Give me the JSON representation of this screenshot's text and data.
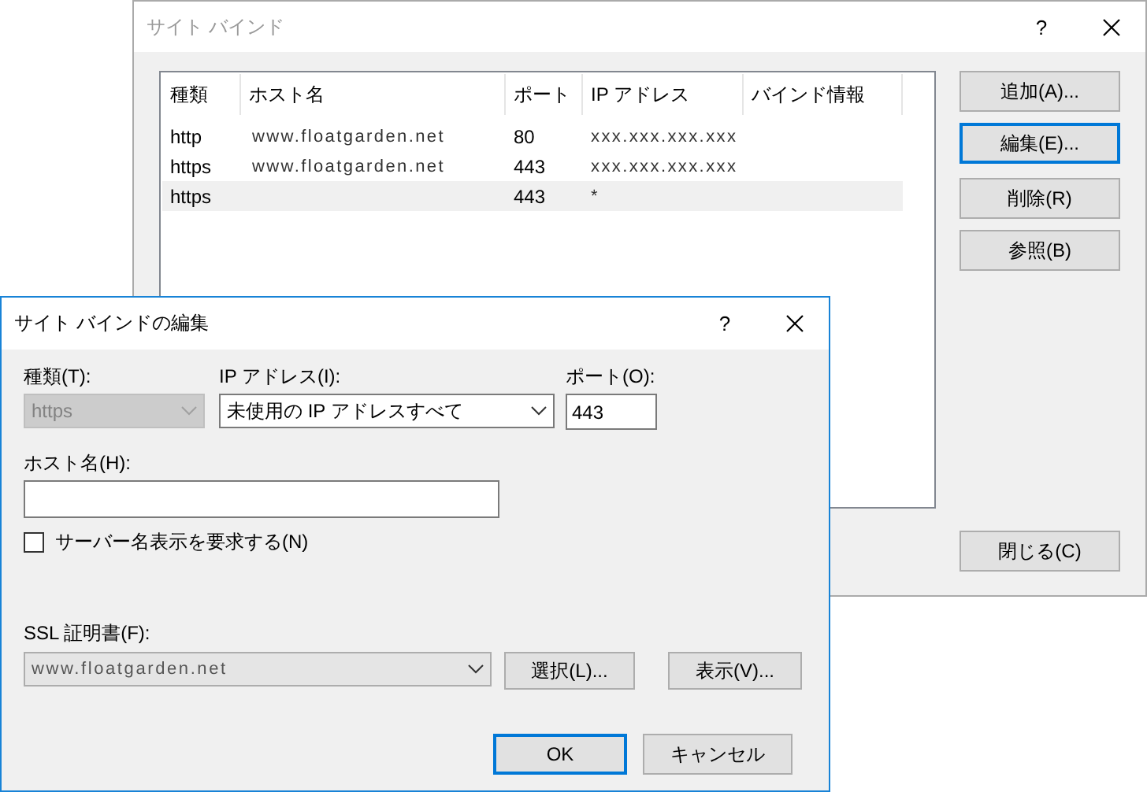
{
  "bindings_window": {
    "title": "サイト バインド",
    "help": "?",
    "active": false,
    "table": {
      "columns": [
        "種類",
        "ホスト名",
        "ポート",
        "IP アドレス",
        "バインド情報"
      ],
      "rows": [
        {
          "type": "http",
          "host": "www.floatgarden.net",
          "port": "80",
          "ip": "xxx.xxx.xxx.xxx",
          "selected": false
        },
        {
          "type": "https",
          "host": "www.floatgarden.net",
          "port": "443",
          "ip": "xxx.xxx.xxx.xxx",
          "selected": false
        },
        {
          "type": "https",
          "port": "443",
          "ip": "*",
          "selected": true
        }
      ]
    },
    "buttons": [
      {
        "label": "追加(A)...",
        "default": false
      },
      {
        "label": "編集(E)...",
        "default": true
      },
      {
        "label": "削除(R)",
        "default": false
      },
      {
        "label": "参照(B)",
        "default": false
      }
    ],
    "close_button": "閉じる(C)"
  },
  "edit_dialog": {
    "title": "サイト バインドの編集",
    "help": "?",
    "active": true,
    "type": {
      "label": "種類(T):",
      "value": "https",
      "disabled": true
    },
    "ip": {
      "label": "IP アドレス(I):",
      "value": "未使用の IP アドレスすべて",
      "disabled": false
    },
    "port": {
      "label": "ポート(O):",
      "value": "443"
    },
    "host": {
      "label": "ホスト名(H):"
    },
    "sni": {
      "label": "サーバー名表示を要求する(N)",
      "checked": false
    },
    "ssl": {
      "label": "SSL 証明書(F):",
      "value": "www.floatgarden.net"
    },
    "select_button": {
      "label": "選択(L)...",
      "default": false
    },
    "view_button": {
      "label": "表示(V)...",
      "default": false
    },
    "ok_button": {
      "label": "OK",
      "default": true
    },
    "cancel_button": {
      "label": "キャンセル",
      "default": false
    }
  }
}
